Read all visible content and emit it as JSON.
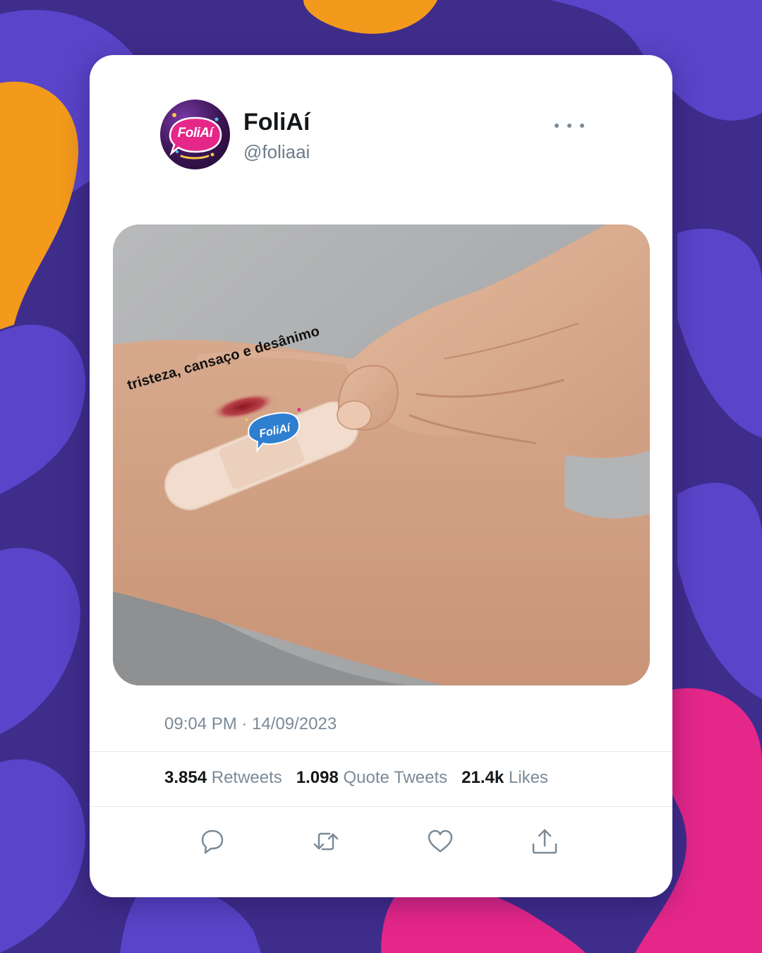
{
  "tweet": {
    "display_name": "FoliAí",
    "handle": "@foliaai",
    "avatar_logo_text": "FoliAí",
    "media": {
      "caption": "tristeza, cansaço e desânimo",
      "bandage_logo_text": "FoliAí"
    },
    "time": "09:04 PM",
    "separator": "·",
    "date": "14/09/2023",
    "stats": {
      "retweets_count": "3.854",
      "retweets_label": "Retweets",
      "quotes_count": "1.098",
      "quotes_label": "Quote Tweets",
      "likes_count": "21.4k",
      "likes_label": "Likes"
    },
    "actions": [
      "reply-icon",
      "retweet-icon",
      "like-icon",
      "share-icon"
    ]
  },
  "colors": {
    "background": "#3f2d8c",
    "blob_purple": "#5a44c9",
    "blob_orange": "#f39a1c",
    "blob_pink": "#e5278a",
    "icon_gray": "#7b8a97"
  }
}
